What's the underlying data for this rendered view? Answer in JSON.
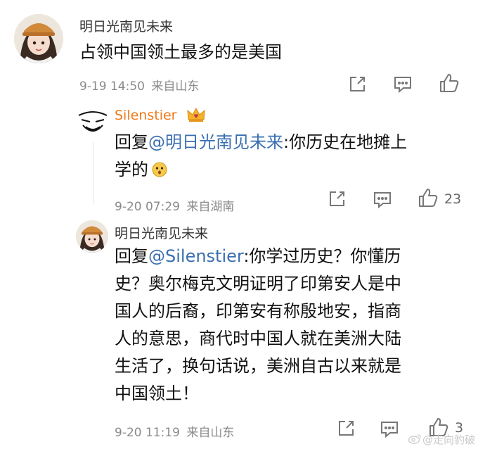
{
  "comment1": {
    "username": "明日光南见未来",
    "text": "占领中国领土最多的是美国",
    "time": "9-19 14:50",
    "location": "来自山东"
  },
  "reply1": {
    "username": "Silenstier",
    "prefix": "回复",
    "mention": "@明日光南见未来",
    "text_line1": ":你历史在地摊上",
    "text_line2": "学的",
    "time": "9-20 07:29",
    "location": "来自湖南",
    "like_count": "23"
  },
  "reply2": {
    "username": "明日光南见未来",
    "prefix": "回复",
    "mention": "@Silenstier",
    "text_line1": ":你学过历史？你懂历",
    "lines": [
      "史？奥尔梅克文明证明了印第安人是中",
      "国人的后裔，印第安有称殷地安，指商",
      "人的意思，商代时中国人就在美洲大陆",
      "生活了，换句话说，美洲自古以来就是",
      "中国领土！"
    ],
    "time": "9-20 11:19",
    "location": "来自山东",
    "like_count": "3"
  },
  "watermark": "@走向豹破",
  "colors": {
    "mention": "#3a6fb0",
    "vip_name": "#ef7a1a",
    "meta": "#8a8a8a"
  },
  "icons": [
    "avatar-girl",
    "avatar-sketch-face",
    "crown-badge-icon",
    "share-icon",
    "comment-icon",
    "like-icon",
    "weibo-logo-icon"
  ]
}
